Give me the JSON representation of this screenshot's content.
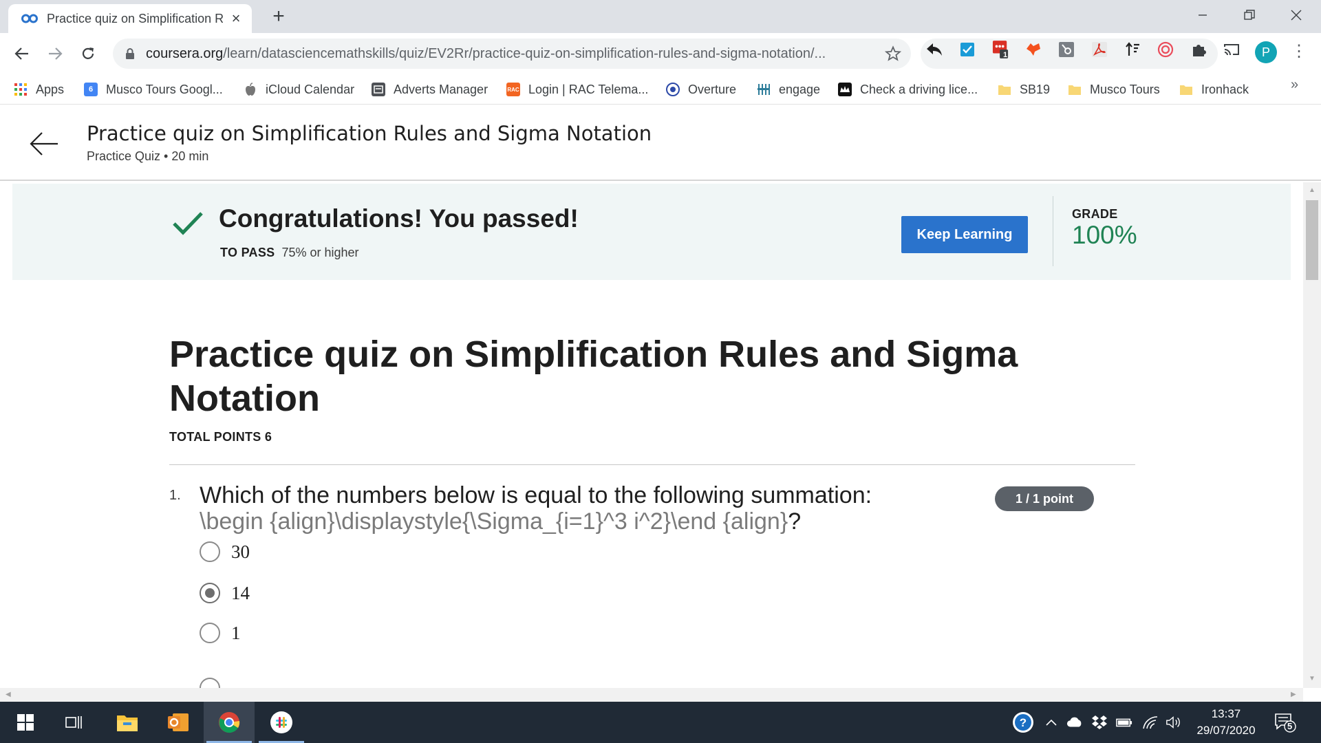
{
  "browser": {
    "tab_title": "Practice quiz on Simplification Rules and Sigma Notation | Coursera",
    "new_tab_label": "+",
    "url_host": "coursera.org",
    "url_path": "/learn/datasciencemathskills/quiz/EV2Rr/practice-quiz-on-simplification-rules-and-sigma-notation/...",
    "profile_initial": "P",
    "extension_badge": "1"
  },
  "bookmarks": {
    "items": [
      {
        "label": "Apps"
      },
      {
        "label": "Musco Tours Googl..."
      },
      {
        "label": "iCloud Calendar"
      },
      {
        "label": "Adverts Manager"
      },
      {
        "label": "Login | RAC Telema..."
      },
      {
        "label": "Overture"
      },
      {
        "label": "engage"
      },
      {
        "label": "Check a driving lice..."
      },
      {
        "label": "SB19"
      },
      {
        "label": "Musco Tours"
      },
      {
        "label": "Ironhack"
      }
    ],
    "more": "»",
    "calendar_day": "6",
    "rac_text": "RAC"
  },
  "header": {
    "title": "Practice quiz on Simplification Rules and Sigma Notation",
    "subtitle": "Practice Quiz • 20 min"
  },
  "banner": {
    "message": "Congratulations! You passed!",
    "to_pass_label": "TO PASS",
    "to_pass_value": "75% or higher",
    "button_label": "Keep Learning",
    "grade_label": "GRADE",
    "grade_value": "100%"
  },
  "quiz": {
    "title": "Practice quiz on Simplification Rules and Sigma Notation",
    "total_points": "TOTAL POINTS 6",
    "questions": [
      {
        "number": "1.",
        "text": "Which of the numbers below is equal to the following summation:",
        "latex": "\\begin {align}\\displaystyle{\\Sigma_{i=1}^3 i^2}\\end {align}",
        "suffix": "?",
        "points": "1 / 1 point",
        "options": [
          {
            "label": "30",
            "selected": false
          },
          {
            "label": "14",
            "selected": true
          },
          {
            "label": "1",
            "selected": false
          }
        ]
      }
    ]
  },
  "taskbar": {
    "time": "13:37",
    "date": "29/07/2020",
    "notification_count": "5"
  },
  "colors": {
    "accent_button": "#2a73cc",
    "grade_green": "#1f8354",
    "banner_bg": "#f0f6f6",
    "points_pill": "#5b6168"
  }
}
